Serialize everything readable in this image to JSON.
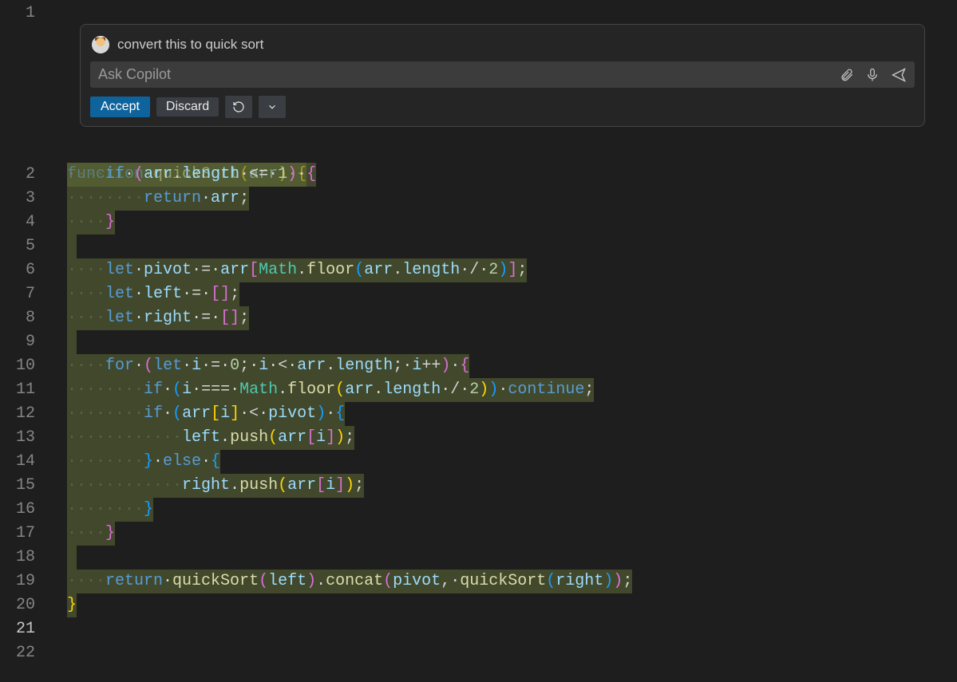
{
  "copilot": {
    "title": "convert this to quick sort",
    "placeholder": "Ask Copilot",
    "accept": "Accept",
    "discard": "Discard"
  },
  "gutter": {
    "numbers": [
      1,
      2,
      3,
      4,
      5,
      6,
      7,
      8,
      9,
      10,
      11,
      12,
      13,
      14,
      15,
      16,
      17,
      18,
      19,
      20,
      21,
      22
    ],
    "active": 21
  },
  "code": {
    "lang": "javascript",
    "raw": "function quickSort(arr) {\n    if (arr.length <= 1) {\n        return arr;\n    }\n\n    let pivot = arr[Math.floor(arr.length / 2)];\n    let left = [];\n    let right = [];\n\n    for (let i = 0; i < arr.length; i++) {\n        if (i === Math.floor(arr.length / 2)) continue;\n        if (arr[i] < pivot) {\n            left.push(arr[i]);\n        } else {\n            right.push(arr[i]);\n        }\n    }\n\n    return quickSort(left).concat(pivot, quickSort(right));\n}",
    "lines": [
      {
        "n": 2,
        "tokens": [
          [
            "kw",
            "function"
          ],
          [
            "punc",
            " "
          ],
          [
            "fn",
            "quickSort"
          ],
          [
            "brace",
            "("
          ],
          [
            "var",
            "arr"
          ],
          [
            "brace",
            ")"
          ],
          [
            "punc",
            " "
          ],
          [
            "brace",
            "{"
          ]
        ]
      },
      {
        "n": 3,
        "indent": 4,
        "tokens": [
          [
            "kw",
            "if"
          ],
          [
            "punc",
            " "
          ],
          [
            "brace2",
            "("
          ],
          [
            "var",
            "arr"
          ],
          [
            "punc",
            "."
          ],
          [
            "var",
            "length"
          ],
          [
            "punc",
            " "
          ],
          [
            "punc",
            "<="
          ],
          [
            "punc",
            " "
          ],
          [
            "num",
            "1"
          ],
          [
            "brace2",
            ")"
          ],
          [
            "punc",
            " "
          ],
          [
            "brace2",
            "{"
          ]
        ]
      },
      {
        "n": 4,
        "indent": 8,
        "tokens": [
          [
            "kw",
            "return"
          ],
          [
            "punc",
            " "
          ],
          [
            "var",
            "arr"
          ],
          [
            "punc",
            ";"
          ]
        ]
      },
      {
        "n": 5,
        "indent": 4,
        "tokens": [
          [
            "brace2",
            "}"
          ]
        ]
      },
      {
        "n": 6,
        "blank": true
      },
      {
        "n": 7,
        "indent": 4,
        "tokens": [
          [
            "kw",
            "let"
          ],
          [
            "punc",
            " "
          ],
          [
            "var",
            "pivot"
          ],
          [
            "punc",
            " "
          ],
          [
            "punc",
            "="
          ],
          [
            "punc",
            " "
          ],
          [
            "var",
            "arr"
          ],
          [
            "brace2",
            "["
          ],
          [
            "cls",
            "Math"
          ],
          [
            "punc",
            "."
          ],
          [
            "fn",
            "floor"
          ],
          [
            "brace3",
            "("
          ],
          [
            "var",
            "arr"
          ],
          [
            "punc",
            "."
          ],
          [
            "var",
            "length"
          ],
          [
            "punc",
            " "
          ],
          [
            "punc",
            "/"
          ],
          [
            "punc",
            " "
          ],
          [
            "num",
            "2"
          ],
          [
            "brace3",
            ")"
          ],
          [
            "brace2",
            "]"
          ],
          [
            "punc",
            ";"
          ]
        ]
      },
      {
        "n": 8,
        "indent": 4,
        "tokens": [
          [
            "kw",
            "let"
          ],
          [
            "punc",
            " "
          ],
          [
            "var",
            "left"
          ],
          [
            "punc",
            " "
          ],
          [
            "punc",
            "="
          ],
          [
            "punc",
            " "
          ],
          [
            "brace2",
            "["
          ],
          [
            "brace2",
            "]"
          ],
          [
            "punc",
            ";"
          ]
        ]
      },
      {
        "n": 9,
        "indent": 4,
        "tokens": [
          [
            "kw",
            "let"
          ],
          [
            "punc",
            " "
          ],
          [
            "var",
            "right"
          ],
          [
            "punc",
            " "
          ],
          [
            "punc",
            "="
          ],
          [
            "punc",
            " "
          ],
          [
            "brace2",
            "["
          ],
          [
            "brace2",
            "]"
          ],
          [
            "punc",
            ";"
          ]
        ]
      },
      {
        "n": 10,
        "blank": true
      },
      {
        "n": 11,
        "indent": 4,
        "tokens": [
          [
            "kw",
            "for"
          ],
          [
            "punc",
            " "
          ],
          [
            "brace2",
            "("
          ],
          [
            "kw",
            "let"
          ],
          [
            "punc",
            " "
          ],
          [
            "var",
            "i"
          ],
          [
            "punc",
            " "
          ],
          [
            "punc",
            "="
          ],
          [
            "punc",
            " "
          ],
          [
            "num",
            "0"
          ],
          [
            "punc",
            ";"
          ],
          [
            "punc",
            " "
          ],
          [
            "var",
            "i"
          ],
          [
            "punc",
            " "
          ],
          [
            "punc",
            "<"
          ],
          [
            "punc",
            " "
          ],
          [
            "var",
            "arr"
          ],
          [
            "punc",
            "."
          ],
          [
            "var",
            "length"
          ],
          [
            "punc",
            ";"
          ],
          [
            "punc",
            " "
          ],
          [
            "var",
            "i"
          ],
          [
            "punc",
            "++"
          ],
          [
            "brace2",
            ")"
          ],
          [
            "punc",
            " "
          ],
          [
            "brace2",
            "{"
          ]
        ]
      },
      {
        "n": 12,
        "indent": 8,
        "tokens": [
          [
            "kw",
            "if"
          ],
          [
            "punc",
            " "
          ],
          [
            "brace3",
            "("
          ],
          [
            "var",
            "i"
          ],
          [
            "punc",
            " "
          ],
          [
            "punc",
            "==="
          ],
          [
            "punc",
            " "
          ],
          [
            "cls",
            "Math"
          ],
          [
            "punc",
            "."
          ],
          [
            "fn",
            "floor"
          ],
          [
            "brace",
            "("
          ],
          [
            "var",
            "arr"
          ],
          [
            "punc",
            "."
          ],
          [
            "var",
            "length"
          ],
          [
            "punc",
            " "
          ],
          [
            "punc",
            "/"
          ],
          [
            "punc",
            " "
          ],
          [
            "num",
            "2"
          ],
          [
            "brace",
            ")"
          ],
          [
            "brace3",
            ")"
          ],
          [
            "punc",
            " "
          ],
          [
            "kw",
            "continue"
          ],
          [
            "punc",
            ";"
          ]
        ]
      },
      {
        "n": 13,
        "indent": 8,
        "tokens": [
          [
            "kw",
            "if"
          ],
          [
            "punc",
            " "
          ],
          [
            "brace3",
            "("
          ],
          [
            "var",
            "arr"
          ],
          [
            "brace",
            "["
          ],
          [
            "var",
            "i"
          ],
          [
            "brace",
            "]"
          ],
          [
            "punc",
            " "
          ],
          [
            "punc",
            "<"
          ],
          [
            "punc",
            " "
          ],
          [
            "var",
            "pivot"
          ],
          [
            "brace3",
            ")"
          ],
          [
            "punc",
            " "
          ],
          [
            "brace3",
            "{"
          ]
        ]
      },
      {
        "n": 14,
        "indent": 12,
        "tokens": [
          [
            "var",
            "left"
          ],
          [
            "punc",
            "."
          ],
          [
            "fn",
            "push"
          ],
          [
            "brace",
            "("
          ],
          [
            "var",
            "arr"
          ],
          [
            "brace2",
            "["
          ],
          [
            "var",
            "i"
          ],
          [
            "brace2",
            "]"
          ],
          [
            "brace",
            ")"
          ],
          [
            "punc",
            ";"
          ]
        ]
      },
      {
        "n": 15,
        "indent": 8,
        "tokens": [
          [
            "brace3",
            "}"
          ],
          [
            "punc",
            " "
          ],
          [
            "kw",
            "else"
          ],
          [
            "punc",
            " "
          ],
          [
            "brace3",
            "{"
          ]
        ]
      },
      {
        "n": 16,
        "indent": 12,
        "tokens": [
          [
            "var",
            "right"
          ],
          [
            "punc",
            "."
          ],
          [
            "fn",
            "push"
          ],
          [
            "brace",
            "("
          ],
          [
            "var",
            "arr"
          ],
          [
            "brace2",
            "["
          ],
          [
            "var",
            "i"
          ],
          [
            "brace2",
            "]"
          ],
          [
            "brace",
            ")"
          ],
          [
            "punc",
            ";"
          ]
        ]
      },
      {
        "n": 17,
        "indent": 8,
        "tokens": [
          [
            "brace3",
            "}"
          ]
        ]
      },
      {
        "n": 18,
        "indent": 4,
        "tokens": [
          [
            "brace2",
            "}"
          ]
        ]
      },
      {
        "n": 19,
        "blank": true
      },
      {
        "n": 20,
        "indent": 4,
        "tokens": [
          [
            "kw",
            "return"
          ],
          [
            "punc",
            " "
          ],
          [
            "fn",
            "quickSort"
          ],
          [
            "brace2",
            "("
          ],
          [
            "var",
            "left"
          ],
          [
            "brace2",
            ")"
          ],
          [
            "punc",
            "."
          ],
          [
            "fn",
            "concat"
          ],
          [
            "brace2",
            "("
          ],
          [
            "var",
            "pivot"
          ],
          [
            "punc",
            ","
          ],
          [
            "punc",
            " "
          ],
          [
            "fn",
            "quickSort"
          ],
          [
            "brace3",
            "("
          ],
          [
            "var",
            "right"
          ],
          [
            "brace3",
            ")"
          ],
          [
            "brace2",
            ")"
          ],
          [
            "punc",
            ";"
          ]
        ]
      },
      {
        "n": 21,
        "tokens": [
          [
            "brace",
            "}"
          ]
        ]
      }
    ]
  }
}
